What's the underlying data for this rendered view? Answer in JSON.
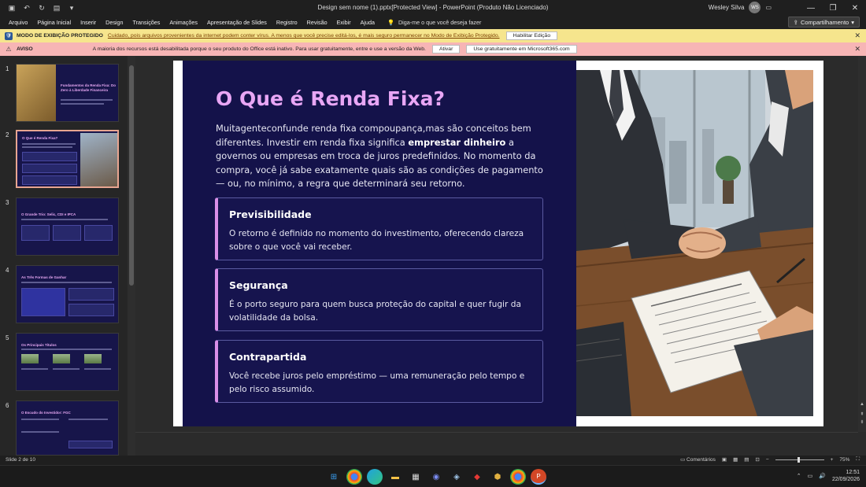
{
  "window": {
    "title": "Design sem nome (1).pptx[Protected View]  -  PowerPoint (Produto Não Licenciado)",
    "user_name": "Wesley Silva",
    "user_initials": "WS"
  },
  "ribbon": {
    "tabs": [
      "Arquivo",
      "Página Inicial",
      "Inserir",
      "Design",
      "Transições",
      "Animações",
      "Apresentação de Slides",
      "Registro",
      "Revisão",
      "Exibir",
      "Ajuda"
    ],
    "tell_me": "Diga-me o que você deseja fazer",
    "share_label": "Compartilhamento"
  },
  "protected_bar": {
    "label": "MODO DE EXIBIÇÃO PROTEGIDO",
    "message": "Cuidado, pois arquivos provenientes da internet podem conter vírus. A menos que você precise editá-los, é mais seguro permanecer no Modo de Exibição Protegido.",
    "button": "Habilitar Edição"
  },
  "warning_bar": {
    "label": "AVISO",
    "message": "A maioria dos recursos está desabilitada porque o seu produto do Office está inativo. Para usar gratuitamente, entre e use a versão da Web.",
    "button_activate": "Ativar",
    "button_free": "Use gratuitamente em Microsoft365.com"
  },
  "thumbnails": [
    {
      "num": "1",
      "title": "Fundamentos da Renda Fixa: Do Zero à Liberdade Financeira"
    },
    {
      "num": "2",
      "title": "O Que é Renda Fixa?"
    },
    {
      "num": "3",
      "title": "O Grande Trio: Selic, CDI e IPCA"
    },
    {
      "num": "4",
      "title": "As Três Formas de Ganhar"
    },
    {
      "num": "5",
      "title": "Os Principais Títulos"
    },
    {
      "num": "6",
      "title": "O Escudo do Investidor: FGC"
    }
  ],
  "slide": {
    "title": "O Que é Renda Fixa?",
    "body_part1": "Muitagenteconfunde renda fixa compoupança,mas são conceitos bem diferentes. Investir em renda fixa significa ",
    "body_bold": "emprestar dinheiro",
    "body_part2": " a governos ou empresas em troca de juros predefinidos. No momento da compra, você já sabe exatamente quais são as condições de pagamento — ou, no mínimo, a regra que determinará seu retorno.",
    "cards": [
      {
        "title": "Previsibilidade",
        "text": "O retorno é definido no momento do investimento, oferecendo clareza sobre o que você vai receber."
      },
      {
        "title": "Segurança",
        "text": "É o porto seguro para quem busca proteção do capital e quer fugir da volatilidade da bolsa."
      },
      {
        "title": "Contrapartida",
        "text": "Você recebe juros pelo empréstimo — uma remuneração pelo tempo e pelo risco assumido."
      }
    ]
  },
  "status": {
    "slide_counter": "Slide 2 de 10",
    "comments": "Comentários",
    "zoom": "75%"
  },
  "taskbar": {
    "time": "12:51",
    "date": "22/09/2026"
  }
}
